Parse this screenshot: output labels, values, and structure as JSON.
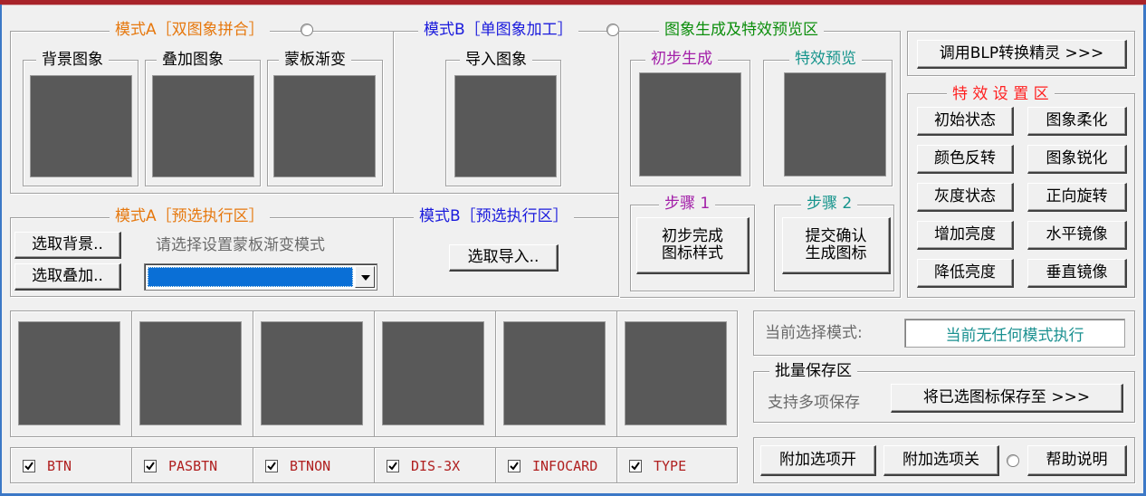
{
  "mode_a": {
    "title": "模式A［双图象拼合］",
    "bg_label": "背景图象",
    "overlay_label": "叠加图象",
    "mask_label": "蒙板渐变"
  },
  "mode_b": {
    "title": "模式B［单图象加工］",
    "import_label": "导入图象"
  },
  "preview": {
    "title": "图象生成及特效预览区",
    "initial_label": "初步生成",
    "effect_label": "特效预览",
    "step1_label": "步骤 1",
    "step1_button": "初步完成\n图标样式",
    "step2_label": "步骤 2",
    "step2_button": "提交确认\n生成图标"
  },
  "blp_button": "调用BLP转换精灵 >>>",
  "effects": {
    "title": "特 效 设 置 区",
    "buttons": [
      "初始状态",
      "图象柔化",
      "颜色反转",
      "图象锐化",
      "灰度状态",
      "正向旋转",
      "增加亮度",
      "水平镜像",
      "降低亮度",
      "垂直镜像"
    ]
  },
  "mode_a_exec": {
    "title": "模式A［预选执行区］",
    "select_bg": "选取背景..",
    "select_overlay": "选取叠加..",
    "mask_hint": "请选择设置蒙板渐变模式"
  },
  "mode_b_exec": {
    "title": "模式B［预选执行区］",
    "select_import": "选取导入.."
  },
  "current_mode": {
    "label": "当前选择模式:",
    "value": "当前无任何模式执行"
  },
  "batch_save": {
    "title": "批量保存区",
    "hint": "支持多项保存",
    "button": "将已选图标保存至 >>>"
  },
  "checkboxes": [
    {
      "label": "BTN",
      "checked": true
    },
    {
      "label": "PASBTN",
      "checked": true
    },
    {
      "label": "BTNON",
      "checked": true
    },
    {
      "label": "DIS-3X",
      "checked": true
    },
    {
      "label": "INFOCARD",
      "checked": true
    },
    {
      "label": "TYPE",
      "checked": true
    }
  ],
  "bottom_buttons": {
    "extra_on": "附加选项开",
    "extra_off": "附加选项关",
    "help": "帮助说明"
  },
  "colors": {
    "title_bar": "#a8232a",
    "tile": "#595959",
    "selection": "#0a6fd6"
  }
}
